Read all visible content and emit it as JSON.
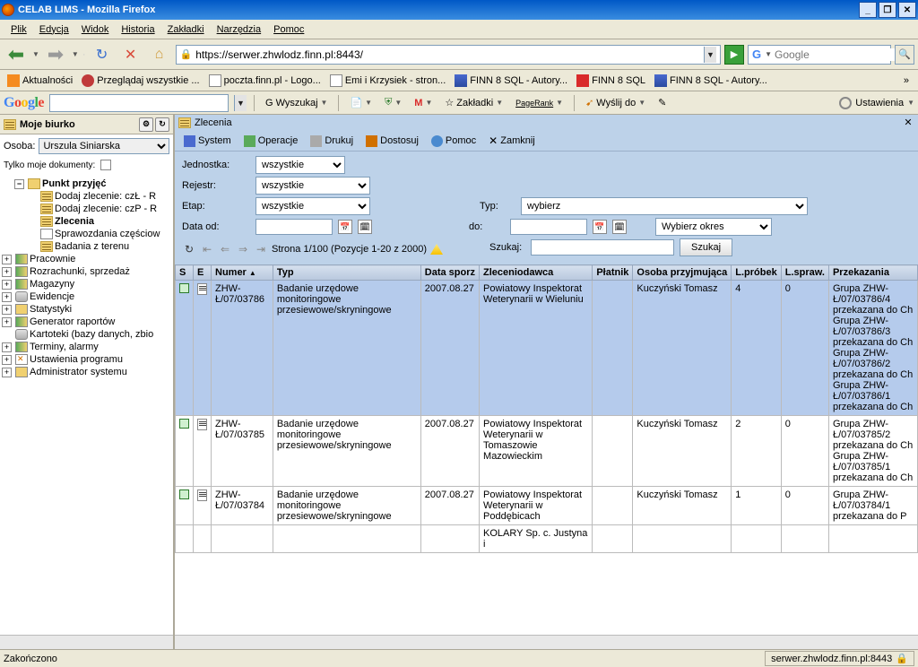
{
  "window": {
    "title": "CELAB LIMS - Mozilla Firefox"
  },
  "menubar": [
    "Plik",
    "Edycja",
    "Widok",
    "Historia",
    "Zakładki",
    "Narzędzia",
    "Pomoc"
  ],
  "url": "https://serwer.zhwlodz.finn.pl:8443/",
  "search_placeholder": "Google",
  "bookmarks": [
    "Aktualności",
    "Przeglądaj wszystkie ...",
    "poczta.finn.pl - Logo...",
    "Emi i Krzysiek - stron...",
    "FINN 8 SQL - Autory...",
    "FINN 8 SQL",
    "FINN 8 SQL - Autory..."
  ],
  "google_toolbar": {
    "search": "Wyszukaj",
    "bookmarks": "Zakładki",
    "pagerank": "PageRank",
    "send": "Wyślij do",
    "settings": "Ustawienia"
  },
  "sidebar": {
    "title": "Moje biurko",
    "osoba_label": "Osoba:",
    "osoba_value": "Urszula Siniarska",
    "docs_label": "Tylko moje dokumenty:",
    "tree": {
      "punkt": "Punkt przyjęć",
      "dodaj1": "Dodaj zlecenie: czŁ - R",
      "dodaj2": "Dodaj zlecenie: czP - R",
      "zlecenia": "Zlecenia",
      "sprawozdania": "Sprawozdania częściow",
      "badania": "Badania z terenu",
      "pracownie": "Pracownie",
      "rozrachunki": "Rozrachunki, sprzedaż",
      "magazyny": "Magazyny",
      "ewidencje": "Ewidencje",
      "statystyki": "Statystyki",
      "generator": "Generator raportów",
      "kartoteki": "Kartoteki (bazy danych, zbio",
      "terminy": "Terminy, alarmy",
      "ustawienia": "Ustawienia programu",
      "admin": "Administrator systemu"
    }
  },
  "main": {
    "title": "Zlecenia",
    "menu": {
      "system": "System",
      "operacje": "Operacje",
      "drukuj": "Drukuj",
      "dostosuj": "Dostosuj",
      "pomoc": "Pomoc",
      "zamknij": "Zamknij"
    },
    "filters": {
      "jednostka_label": "Jednostka:",
      "jednostka_value": "wszystkie",
      "rejestr_label": "Rejestr:",
      "rejestr_value": "wszystkie",
      "etap_label": "Etap:",
      "etap_value": "wszystkie",
      "typ_label": "Typ:",
      "typ_value": "wybierz",
      "data_od_label": "Data od:",
      "do_label": "do:",
      "okres_value": "Wybierz okres",
      "szukaj_label": "Szukaj:",
      "szukaj_button": "Szukaj"
    },
    "pager": "Strona 1/100 (Pozycje 1-20 z 2000)",
    "columns": [
      "S",
      "E",
      "Numer",
      "Typ",
      "Data sporz",
      "Zleceniodawca",
      "Płatnik",
      "Osoba przyjmująca",
      "L.próbek",
      "L.spraw.",
      "Przekazania"
    ],
    "rows": [
      {
        "numer": "ZHW-Ł/07/03786",
        "typ": "Badanie urzędowe monitoringowe przesiewowe/skryningowe",
        "data": "2007.08.27",
        "zlec": "Powiatowy Inspektorat Weterynarii w Wieluniu",
        "platnik": "",
        "osoba": "Kuczyński Tomasz",
        "lprob": "4",
        "lspr": "0",
        "przek": "Grupa ZHW-Ł/07/03786/4 przekazana do Ch\nGrupa ZHW-Ł/07/03786/3 przekazana do Ch\nGrupa ZHW-Ł/07/03786/2 przekazana do Ch\nGrupa ZHW-Ł/07/03786/1 przekazana do Ch"
      },
      {
        "numer": "ZHW-Ł/07/03785",
        "typ": "Badanie urzędowe monitoringowe przesiewowe/skryningowe",
        "data": "2007.08.27",
        "zlec": "Powiatowy Inspektorat Weterynarii w Tomaszowie Mazowieckim",
        "platnik": "",
        "osoba": "Kuczyński Tomasz",
        "lprob": "2",
        "lspr": "0",
        "przek": "Grupa ZHW-Ł/07/03785/2 przekazana do Ch\nGrupa ZHW-Ł/07/03785/1 przekazana do Ch"
      },
      {
        "numer": "ZHW-Ł/07/03784",
        "typ": "Badanie urzędowe monitoringowe przesiewowe/skryningowe",
        "data": "2007.08.27",
        "zlec": "Powiatowy Inspektorat Weterynarii w Poddębicach",
        "platnik": "",
        "osoba": "Kuczyński Tomasz",
        "lprob": "1",
        "lspr": "0",
        "przek": "Grupa ZHW-Ł/07/03784/1 przekazana do P"
      },
      {
        "numer": "",
        "typ": "",
        "data": "",
        "zlec": "KOLARY Sp. c. Justyna i",
        "platnik": "",
        "osoba": "",
        "lprob": "",
        "lspr": "",
        "przek": ""
      }
    ]
  },
  "status": {
    "left": "Zakończono",
    "right": "serwer.zhwlodz.finn.pl:8443"
  }
}
